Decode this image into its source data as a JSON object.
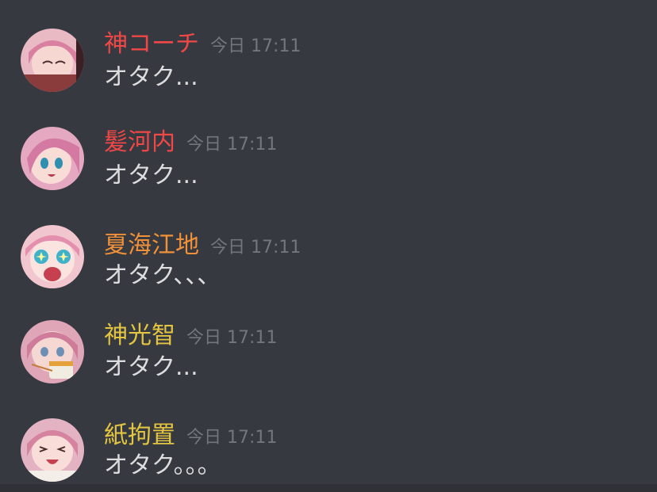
{
  "messages": [
    {
      "username": "神コーチ",
      "name_color": "#f04747",
      "timestamp": "今日 17:11",
      "text": "オタク..."
    },
    {
      "username": "髪河内",
      "name_color": "#f04747",
      "timestamp": "今日 17:11",
      "text": "オタク..."
    },
    {
      "username": "夏海江地",
      "name_color": "#f0913a",
      "timestamp": "今日 17:11",
      "text": "オタク、、、"
    },
    {
      "username": "神光智",
      "name_color": "#e3c542",
      "timestamp": "今日 17:11",
      "text": "オタク..."
    },
    {
      "username": "紙拘置",
      "name_color": "#e3c542",
      "timestamp": "今日 17:11",
      "text": "オタク。。。"
    }
  ]
}
